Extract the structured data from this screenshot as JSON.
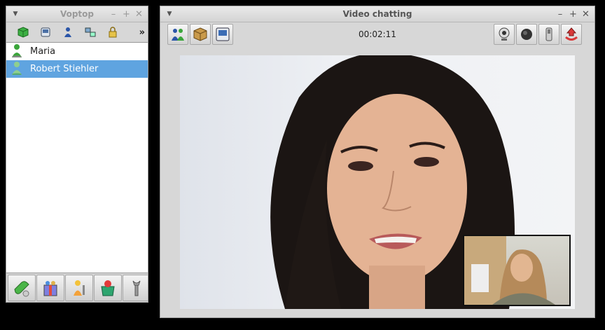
{
  "contacts_window": {
    "title": "Voptop",
    "controls": [
      "–",
      "+",
      "✕"
    ],
    "toolbar_icons": [
      "green-cube-icon",
      "device-icon",
      "contact-icon",
      "network-icon",
      "lock-icon"
    ],
    "overflow_label": "»",
    "contacts": [
      {
        "name": "Maria",
        "status_color": "#3aa53a",
        "selected": false
      },
      {
        "name": "Robert Stiehler",
        "status_color": "#6fb26f",
        "selected": true
      }
    ],
    "bottom_buttons": [
      "call-icon",
      "gift-icon",
      "settings-person-icon",
      "add-contact-icon",
      "wrench-icon"
    ]
  },
  "video_window": {
    "title": "Video chatting",
    "controls": [
      "–",
      "+",
      "✕"
    ],
    "timer": "00:02:11",
    "left_tools": [
      "users-icon",
      "package-icon",
      "screen-icon"
    ],
    "right_tools": [
      "webcam-icon",
      "record-icon",
      "phone-icon",
      "hangup-icon"
    ]
  },
  "colors": {
    "selection": "#5fa4e0",
    "window_bg": "#d7d7d7"
  }
}
